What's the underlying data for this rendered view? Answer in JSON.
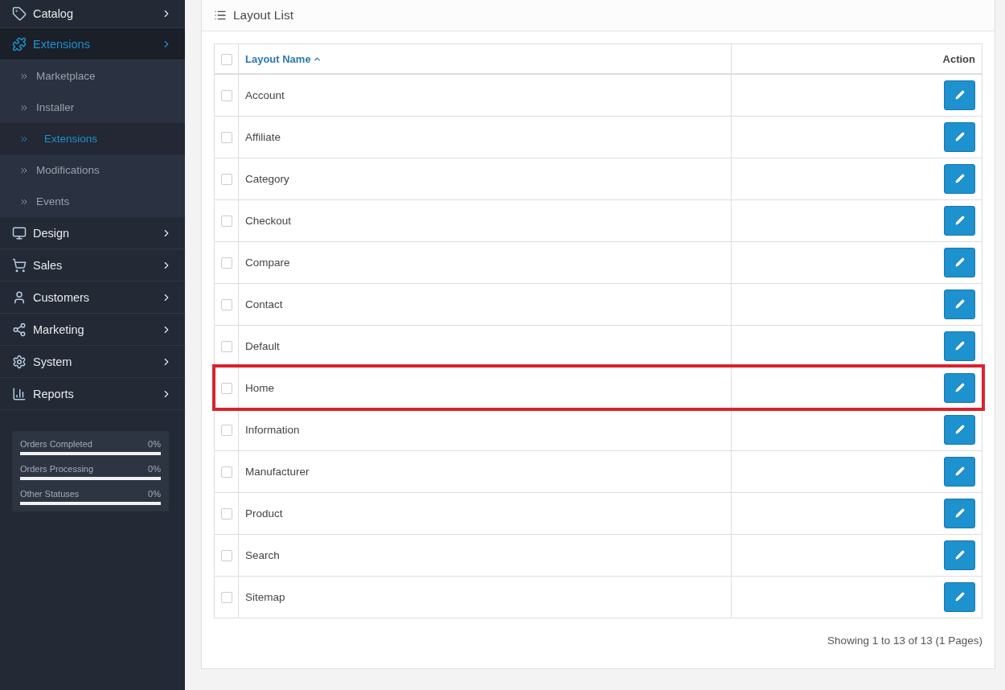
{
  "sidebar": {
    "menu": [
      {
        "label": "Catalog",
        "selected": false
      },
      {
        "label": "Extensions",
        "selected": true,
        "children": [
          {
            "label": "Marketplace",
            "selected": false
          },
          {
            "label": "Installer",
            "selected": false
          },
          {
            "label": "Extensions",
            "selected": true
          },
          {
            "label": "Modifications",
            "selected": false
          },
          {
            "label": "Events",
            "selected": false
          }
        ]
      },
      {
        "label": "Design",
        "selected": false
      },
      {
        "label": "Sales",
        "selected": false
      },
      {
        "label": "Customers",
        "selected": false
      },
      {
        "label": "Marketing",
        "selected": false
      },
      {
        "label": "System",
        "selected": false
      },
      {
        "label": "Reports",
        "selected": false
      }
    ],
    "stats": [
      {
        "label": "Orders Completed",
        "reading": "0%",
        "level": 0
      },
      {
        "label": "Orders Processing",
        "reading": "0%",
        "level": 0
      },
      {
        "label": "Other Statuses",
        "reading": "0%",
        "level": 0
      }
    ]
  },
  "panel": {
    "title": "Layout List",
    "table": {
      "select_all_checked": false,
      "columns": [
        {
          "label": "Layout Name",
          "sorted": true
        },
        {
          "label": "Action",
          "sorted": false
        }
      ],
      "rows": [
        {
          "name": "Account",
          "checked": false,
          "highlighted": false
        },
        {
          "name": "Affiliate",
          "checked": false,
          "highlighted": false
        },
        {
          "name": "Category",
          "checked": false,
          "highlighted": false
        },
        {
          "name": "Checkout",
          "checked": false,
          "highlighted": false
        },
        {
          "name": "Compare",
          "checked": false,
          "highlighted": false
        },
        {
          "name": "Contact",
          "checked": false,
          "highlighted": false
        },
        {
          "name": "Default",
          "checked": false,
          "highlighted": false
        },
        {
          "name": "Home",
          "checked": false,
          "highlighted": true
        },
        {
          "name": "Information",
          "checked": false,
          "highlighted": false
        },
        {
          "name": "Manufacturer",
          "checked": false,
          "highlighted": false
        },
        {
          "name": "Product",
          "checked": false,
          "highlighted": false
        },
        {
          "name": "Search",
          "checked": false,
          "highlighted": false
        },
        {
          "name": "Sitemap",
          "checked": false,
          "highlighted": false
        }
      ]
    },
    "pagination_text": "Showing 1 to 13 of 13 (1 Pages)"
  }
}
